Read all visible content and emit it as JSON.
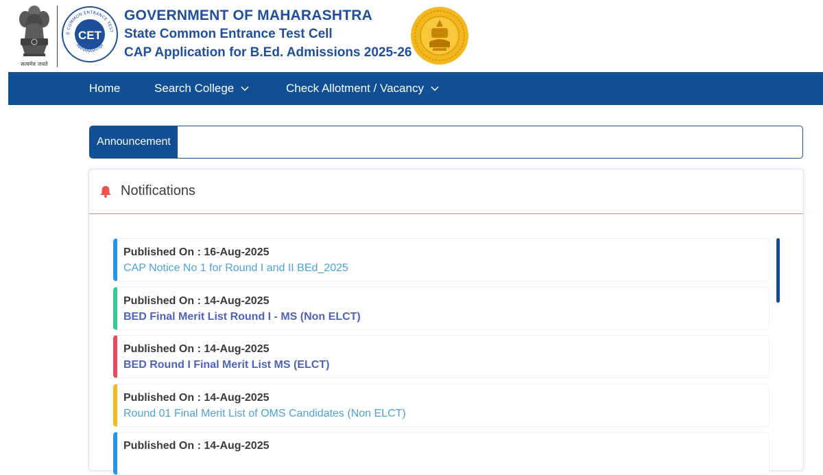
{
  "header": {
    "emblem_motto": "सत्यमेव जयते",
    "title_line1": "GOVERNMENT OF MAHARASHTRA",
    "title_line2": "State Common Entrance Test Cell",
    "title_line3": "CAP Application for B.Ed. Admissions 2025-26",
    "cet_logo": {
      "top_text": "STATE COMMON ENTRANCE TEST CELL",
      "center_text": "CET",
      "bottom_text": "MAHARASHTRA"
    }
  },
  "nav": {
    "home": "Home",
    "search_college": "Search College",
    "check_allotment": "Check Allotment / Vacancy"
  },
  "announcement": {
    "label": "Announcement",
    "text": ""
  },
  "notifications": {
    "title": "Notifications",
    "items": [
      {
        "published": "Published On : 16-Aug-2025",
        "title": "CAP Notice No 1 for Round I and II BEd_2025",
        "accent": "#2196f3",
        "style": "light"
      },
      {
        "published": "Published On : 14-Aug-2025",
        "title": "BED Final Merit List Round I - MS (Non ELCT)",
        "accent": "#2ecc8f",
        "style": "bold"
      },
      {
        "published": "Published On : 14-Aug-2025",
        "title": "BED Round I Final Merit List MS (ELCT)",
        "accent": "#e84a5f",
        "style": "bold"
      },
      {
        "published": "Published On : 14-Aug-2025",
        "title": "Round 01 Final Merit List of OMS Candidates (Non ELCT)",
        "accent": "#f5b921",
        "style": "light"
      },
      {
        "published": "Published On : 14-Aug-2025",
        "title": "",
        "accent": "#2196f3",
        "style": "light"
      }
    ]
  },
  "colors": {
    "brand_blue": "#114f95",
    "title_blue": "#1e4f9c",
    "link_light": "#4aa3d8",
    "link_bold": "#4d63bb",
    "bell": "#ef5350",
    "seal_gold": "#f2b81e"
  },
  "icons": {
    "emblem": "national-emblem-icon",
    "cet": "cet-logo",
    "seal": "maharashtra-seal",
    "chevron": "chevron-down-icon",
    "bell": "bell-icon"
  }
}
